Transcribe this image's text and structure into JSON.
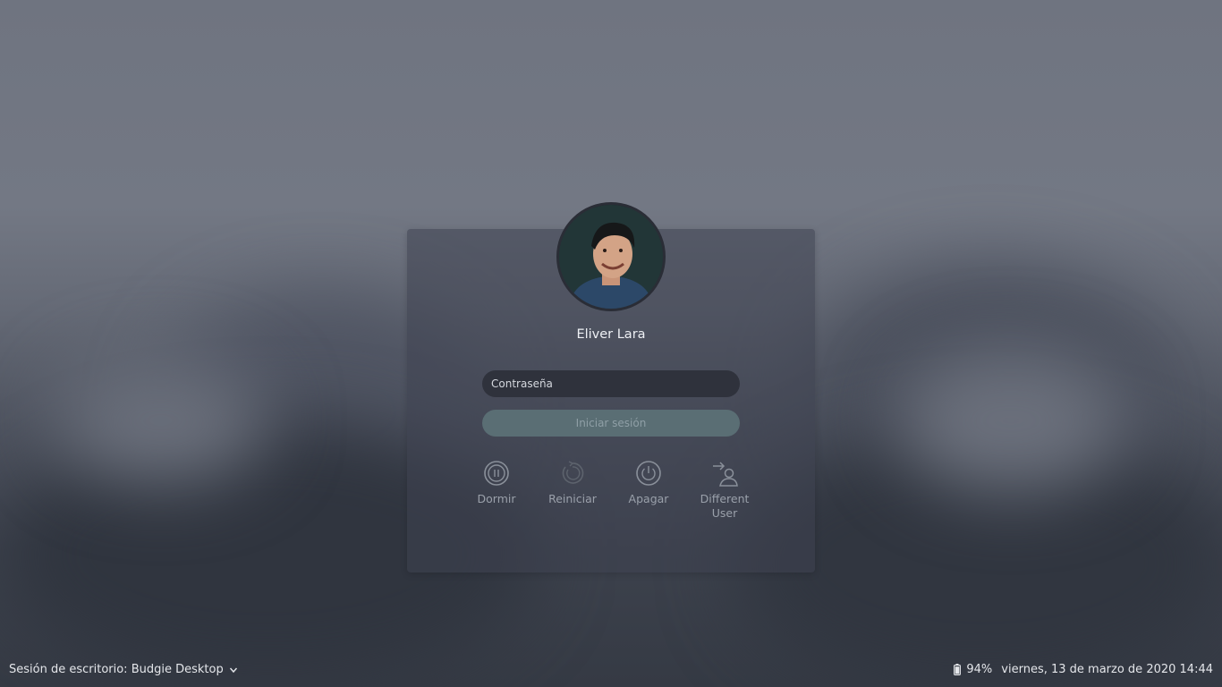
{
  "user": {
    "name": "Eliver Lara"
  },
  "login": {
    "password_placeholder": "Contraseña",
    "password_value": "",
    "submit_label": "Iniciar sesión"
  },
  "actions": [
    {
      "label": "Dormir",
      "icon": "suspend-icon"
    },
    {
      "label": "Reiniciar",
      "icon": "restart-icon"
    },
    {
      "label": "Apagar",
      "icon": "power-icon"
    },
    {
      "label": "Different\nUser",
      "icon": "switch-user-icon"
    }
  ],
  "session": {
    "label": "Sesión de escritorio: Budgie Desktop",
    "icon": "chevron-down-icon"
  },
  "status": {
    "battery_percent": "94%",
    "battery_level": 0.94,
    "datetime": "viernes, 13 de marzo de 2020 14:44"
  },
  "colors": {
    "login_button_bg": "#5a6e74",
    "card_bg": "#3e4250"
  }
}
